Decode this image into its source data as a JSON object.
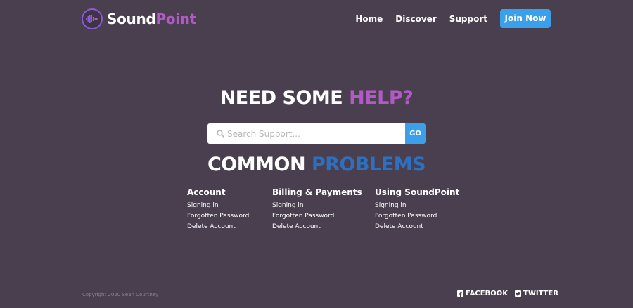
{
  "brand": {
    "name_part1": "Sound",
    "name_part2": "Point",
    "accent": "#b05bc4"
  },
  "nav": {
    "items": [
      "Home",
      "Discover",
      "Support"
    ],
    "cta": "Join Now"
  },
  "hero": {
    "title_part1": "NEED SOME ",
    "title_part2": "HELP?"
  },
  "search": {
    "placeholder": "Search Support...",
    "button": "GO"
  },
  "problems": {
    "title_part1": "COMMON ",
    "title_part2": "PROBLEMS",
    "columns": [
      {
        "heading": "Account",
        "links": [
          "Signing in",
          "Forgotten Password",
          "Delete Account"
        ]
      },
      {
        "heading": "Billing & Payments",
        "links": [
          "Signing in",
          "Forgotten Password",
          "Delete Account"
        ]
      },
      {
        "heading": "Using SoundPoint",
        "links": [
          "Signing in",
          "Forgotten Password",
          "Delete Account"
        ]
      }
    ]
  },
  "footer": {
    "copyright": "Copyright 2020 Sean Courtney",
    "facebook": "FACEBOOK",
    "twitter": "TWITTER"
  },
  "colors": {
    "background": "#4a3f4e",
    "button_blue": "#3aa0ea",
    "problems_blue": "#2f6fc0"
  }
}
